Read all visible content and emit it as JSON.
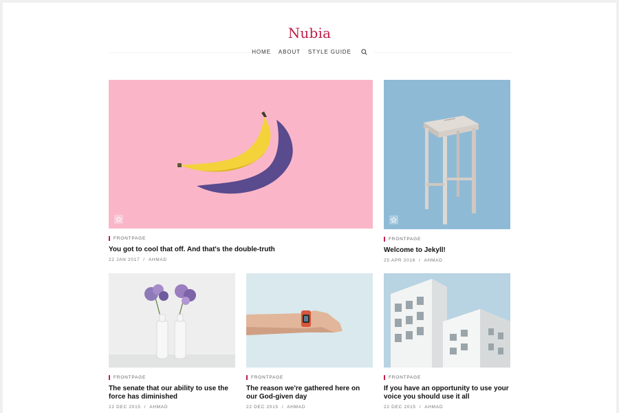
{
  "site": {
    "logo": "Nubia"
  },
  "nav": {
    "items": [
      "HOME",
      "ABOUT",
      "STYLE GUIDE"
    ],
    "search_icon": "search-icon"
  },
  "colors": {
    "accent": "#c01d48",
    "pink": "#fab6c8",
    "blue": "#8fbad6"
  },
  "posts": [
    {
      "category": "FRONTPAGE",
      "title": "You got to cool that off. And that's the double-truth",
      "date": "22 JAN 2017",
      "author": "AHMAD",
      "featured": true
    },
    {
      "category": "FRONTPAGE",
      "title": "Welcome to Jekyll!",
      "date": "25 APR 2016",
      "author": "AHMAD",
      "featured": true
    },
    {
      "category": "FRONTPAGE",
      "title": "The senate that our ability to use the force has diminished",
      "date": "22 DEC 2015",
      "author": "AHMAD",
      "featured": false
    },
    {
      "category": "FRONTPAGE",
      "title": "The reason we're gathered here on our God-given day",
      "date": "22 DEC 2015",
      "author": "AHMAD",
      "featured": false
    },
    {
      "category": "FRONTPAGE",
      "title": "If you have an opportunity to use your voice you should use it all",
      "date": "22 DEC 2015",
      "author": "AHMAD",
      "featured": false
    }
  ]
}
